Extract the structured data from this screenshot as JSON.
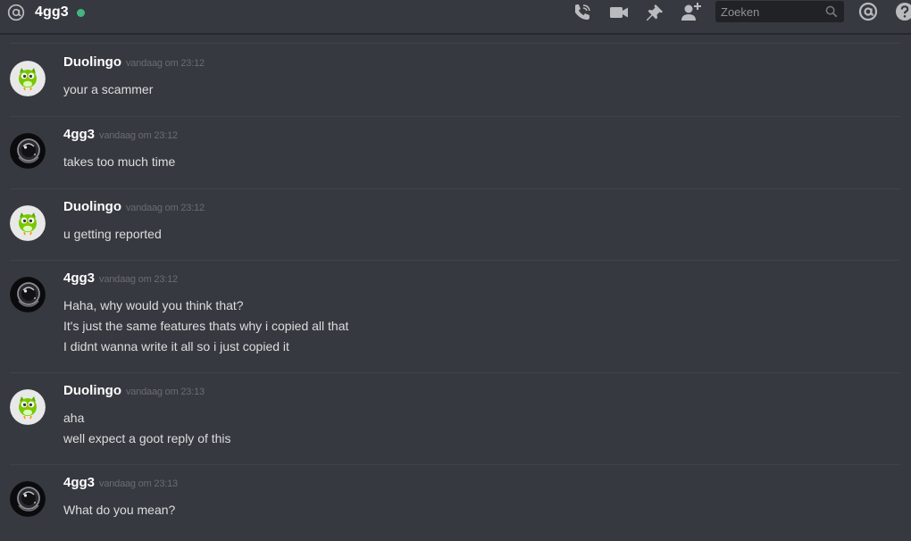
{
  "header": {
    "channel_name": "4gg3",
    "status_color": "#43b581",
    "icons": [
      "at-icon",
      "phone-call-icon",
      "video-icon",
      "pin-icon",
      "add-friend-icon",
      "search-icon",
      "mentions-icon",
      "help-icon"
    ],
    "search_placeholder": "Zoeken"
  },
  "messages": [
    {
      "author": "Duolingo",
      "avatar": "duolingo-owl",
      "timestamp": "vandaag om 23:12",
      "lines": [
        "your a scammer"
      ]
    },
    {
      "author": "4gg3",
      "avatar": "astronaut",
      "timestamp": "vandaag om 23:12",
      "lines": [
        "takes too much time"
      ]
    },
    {
      "author": "Duolingo",
      "avatar": "duolingo-owl",
      "timestamp": "vandaag om 23:12",
      "lines": [
        "u getting reported"
      ]
    },
    {
      "author": "4gg3",
      "avatar": "astronaut",
      "timestamp": "vandaag om 23:12",
      "lines": [
        "Haha, why would you think that?",
        "It's just the same features thats why i copied all that",
        "I didnt wanna write it all so i just copied it"
      ]
    },
    {
      "author": "Duolingo",
      "avatar": "duolingo-owl",
      "timestamp": "vandaag om 23:13",
      "lines": [
        "aha",
        "well expect a goot reply of this"
      ]
    },
    {
      "author": "4gg3",
      "avatar": "astronaut",
      "timestamp": "vandaag om 23:13",
      "lines": [
        "What do you mean?"
      ]
    }
  ]
}
